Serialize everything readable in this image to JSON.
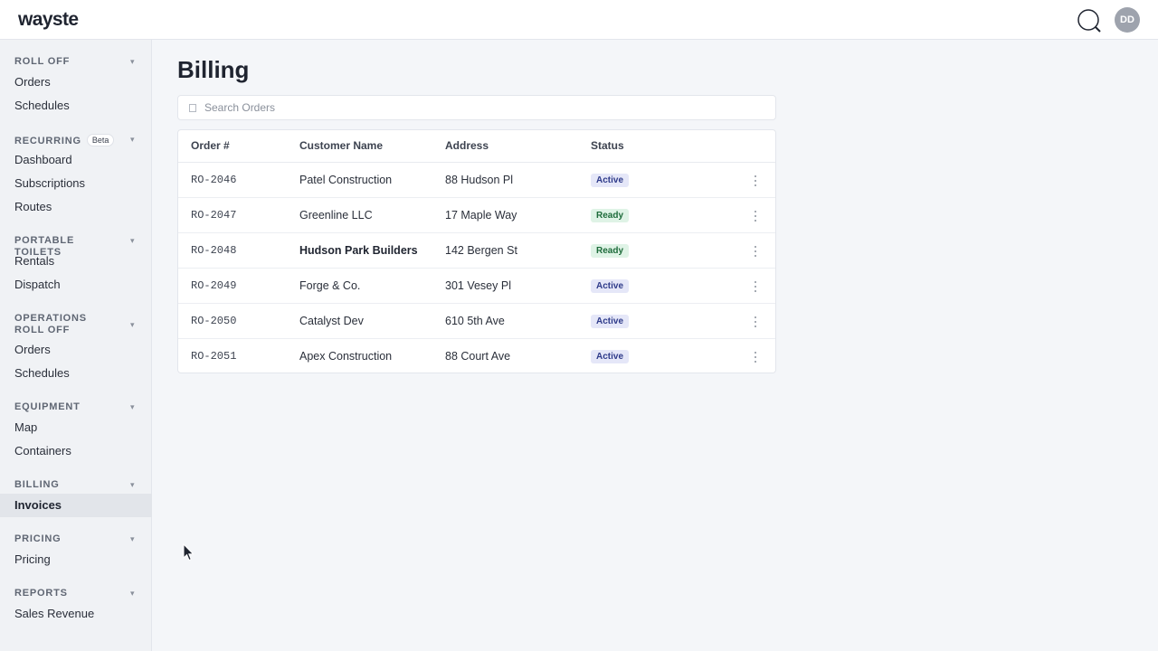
{
  "header": {
    "logo": "wayste",
    "avatar_initials": "DD",
    "search_icon": "search-icon"
  },
  "sidebar": {
    "sections": [
      {
        "title": "Roll Off",
        "items": [
          {
            "label": "Orders"
          },
          {
            "label": "Schedules"
          }
        ]
      },
      {
        "title": "Recurring",
        "badge": "Beta",
        "items": [
          {
            "label": "Dashboard"
          },
          {
            "label": "Subscriptions"
          },
          {
            "label": "Routes"
          }
        ]
      },
      {
        "title": "Portable Toilets",
        "items": [
          {
            "label": "Rentals"
          },
          {
            "label": "Dispatch"
          }
        ]
      },
      {
        "title": "Operations Roll Off",
        "items": [
          {
            "label": "Orders"
          },
          {
            "label": "Schedules"
          }
        ]
      },
      {
        "title": "Equipment",
        "items": [
          {
            "label": "Map"
          },
          {
            "label": "Containers"
          }
        ]
      },
      {
        "title": "Billing",
        "items": [
          {
            "label": "Invoices",
            "active": true
          }
        ]
      },
      {
        "title": "Pricing",
        "items": [
          {
            "label": "Pricing"
          }
        ]
      },
      {
        "title": "Reports",
        "items": [
          {
            "label": "Sales Revenue"
          }
        ]
      }
    ],
    "chevron": "▾"
  },
  "main": {
    "title": "Billing",
    "search": {
      "placeholder": "Search Orders",
      "value": ""
    },
    "table": {
      "columns": [
        "Order #",
        "Customer Name",
        "Address",
        "Status"
      ],
      "rows": [
        {
          "order": "RO-2046",
          "customer": "Patel Construction",
          "address": "88 Hudson Pl",
          "status": "Active"
        },
        {
          "order": "RO-2047",
          "customer": "Greenline LLC",
          "address": "17 Maple Way",
          "status": "Ready"
        },
        {
          "order": "RO-2048",
          "customer": "Hudson Park Builders",
          "address": "142 Bergen St",
          "status": "Ready"
        },
        {
          "order": "RO-2049",
          "customer": "Forge & Co.",
          "address": "301 Vesey Pl",
          "status": "Active"
        },
        {
          "order": "RO-2050",
          "customer": "Catalyst Dev",
          "address": "610 5th Ave",
          "status": "Active"
        },
        {
          "order": "RO-2051",
          "customer": "Apex Construction",
          "address": "88 Court Ave",
          "status": "Active"
        }
      ]
    }
  },
  "colors": {
    "active_badge_bg": "#e5e7f8",
    "active_badge_text": "#2f3b8a",
    "ready_badge_bg": "#dff3e6",
    "ready_badge_text": "#1d6b3a",
    "avatar_bg": "#9ea3ad"
  }
}
